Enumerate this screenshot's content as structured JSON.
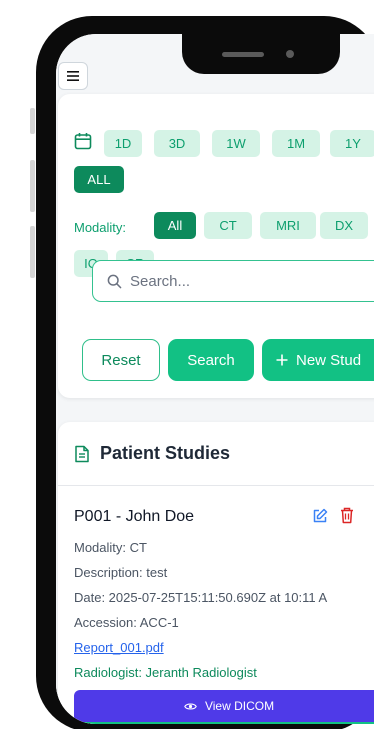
{
  "date_filters": [
    {
      "label": "1D",
      "active": false
    },
    {
      "label": "3D",
      "active": false
    },
    {
      "label": "1W",
      "active": false
    },
    {
      "label": "1M",
      "active": false
    },
    {
      "label": "1Y",
      "active": false
    },
    {
      "label": "ALL",
      "active": true
    }
  ],
  "modality": {
    "label": "Modality:",
    "options": [
      {
        "label": "All",
        "active": true
      },
      {
        "label": "CT",
        "active": false
      },
      {
        "label": "MRI",
        "active": false
      },
      {
        "label": "DX",
        "active": false
      },
      {
        "label": "IO",
        "active": false
      },
      {
        "label": "CR",
        "active": false
      }
    ]
  },
  "search": {
    "placeholder": "Search...",
    "value": ""
  },
  "buttons": {
    "reset": "Reset",
    "search": "Search",
    "new_study": "New Stud"
  },
  "studies": {
    "title": "Patient Studies",
    "record": {
      "title": "P001 - John Doe",
      "modality": "Modality: CT",
      "description": "Description: test",
      "date": "Date: 2025-07-25T15:11:50.690Z at 10:11 A",
      "accession": "Accession: ACC-1",
      "report_link": "Report_001.pdf",
      "radiologist": "Radiologist: Jeranth Radiologist",
      "view_button": "View DICOM"
    }
  },
  "colors": {
    "accent": "#12c184",
    "accent_dark": "#0d8a5c",
    "chip_bg": "#d5f3e6",
    "view_button": "#4f3ae8",
    "delete": "#dc2626",
    "edit": "#3b82f6",
    "link": "#2563eb"
  },
  "icons": [
    "menu-icon",
    "calendar-icon",
    "search-icon",
    "plus-icon",
    "document-icon",
    "edit-icon",
    "trash-icon",
    "eye-icon"
  ]
}
